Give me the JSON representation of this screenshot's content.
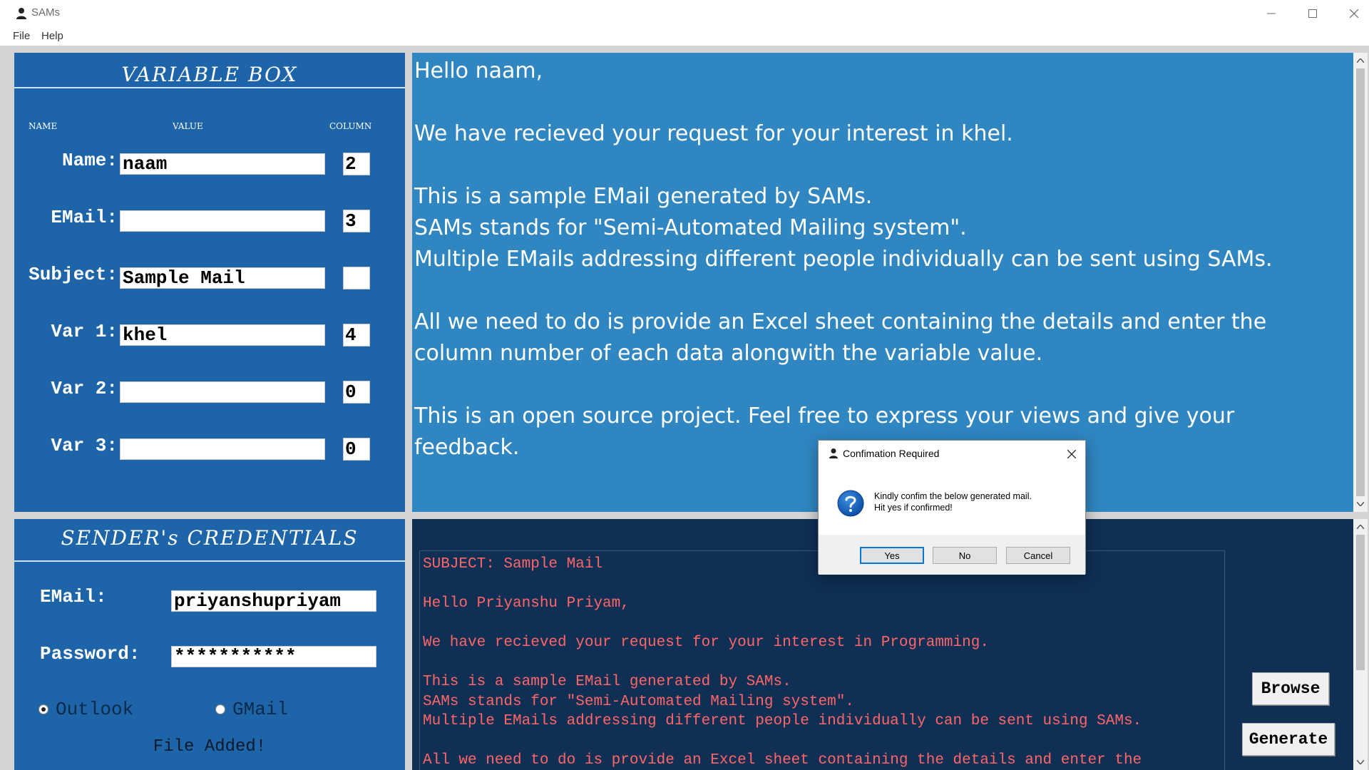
{
  "window": {
    "title": "SAMs"
  },
  "menu": {
    "file": "File",
    "help": "Help"
  },
  "variable_box": {
    "title": "VARIABLE  BOX",
    "headers": {
      "name": "NAME",
      "value": "VALUE",
      "column": "COLUMN"
    },
    "rows": [
      {
        "label": "Name:",
        "value": "naam",
        "column": "2"
      },
      {
        "label": "EMail:",
        "value": "",
        "column": "3"
      },
      {
        "label": "Subject:",
        "value": "Sample Mail",
        "column": ""
      },
      {
        "label": "Var 1:",
        "value": "khel",
        "column": "4"
      },
      {
        "label": "Var 2:",
        "value": "",
        "column": "0"
      },
      {
        "label": "Var 3:",
        "value": "",
        "column": "0"
      }
    ]
  },
  "template_preview": {
    "lines": [
      "Hello naam,",
      "",
      "We have recieved your request for your interest in khel.",
      "",
      "This is a sample EMail generated by SAMs.",
      "SAMs stands for \"Semi-Automated Mailing system\".",
      "Multiple EMails addressing different people individually can be sent using SAMs.",
      "",
      "All we need to do is provide an Excel sheet containing the details and enter the",
      "column number of each data alongwith the variable value.",
      "",
      "This is an open source project. Feel free to express your views and give your",
      "feedback."
    ]
  },
  "credentials": {
    "title": "SENDER's CREDENTIALS",
    "email_label": "EMail:",
    "email_value": "priyanshupriyam",
    "password_label": "Password:",
    "password_value": "***********",
    "radio_outlook": "Outlook",
    "radio_gmail": "GMail",
    "selected": "Outlook",
    "status": "File Added!"
  },
  "generated_mail": {
    "lines": [
      "SUBJECT: Sample Mail",
      "",
      "Hello Priyanshu Priyam,",
      "",
      "We have recieved your request for your interest in Programming.",
      "",
      "This is a sample EMail generated by SAMs.",
      "SAMs stands for \"Semi-Automated Mailing system\".",
      "Multiple EMails addressing different people individually can be sent using SAMs.",
      "",
      "All we need to do is provide an Excel sheet containing the details and enter the"
    ]
  },
  "buttons": {
    "browse": "Browse",
    "generate": "Generate"
  },
  "dialog": {
    "title": "Confimation Required",
    "message_line1": "Kindly confim the below generated mail.",
    "message_line2": "Hit yes if confirmed!",
    "yes": "Yes",
    "no": "No",
    "cancel": "Cancel",
    "icon": "question-icon"
  },
  "colors": {
    "panel_blue": "#1e64a8",
    "preview_blue": "#2f86c1",
    "output_navy": "#0f2f55",
    "output_text": "#ff6666"
  }
}
